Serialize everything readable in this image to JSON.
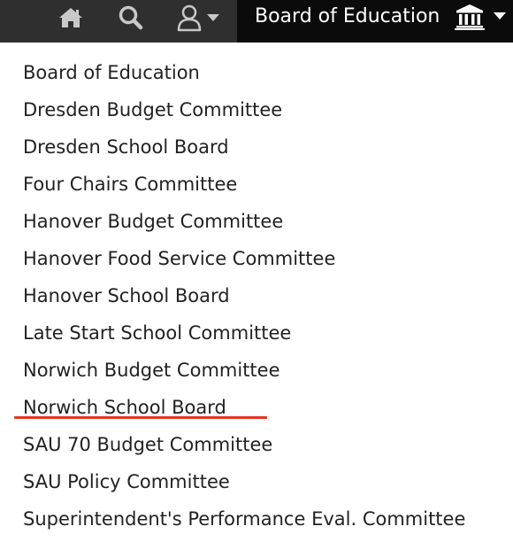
{
  "topbar": {
    "context_title": "Board of Education",
    "icons": {
      "home": "home-icon",
      "search": "search-icon",
      "user": "user-icon",
      "building": "building-icon"
    }
  },
  "menu": {
    "items": [
      {
        "label": "Board of Education"
      },
      {
        "label": "Dresden Budget Committee"
      },
      {
        "label": "Dresden School Board"
      },
      {
        "label": "Four Chairs Committee"
      },
      {
        "label": "Hanover Budget Committee"
      },
      {
        "label": "Hanover Food Service Committee"
      },
      {
        "label": "Hanover School Board"
      },
      {
        "label": "Late Start School Committee"
      },
      {
        "label": "Norwich Budget Committee"
      },
      {
        "label": "Norwich School Board"
      },
      {
        "label": "SAU 70 Budget Committee"
      },
      {
        "label": "SAU Policy Committee"
      },
      {
        "label": "Superintendent's Performance Eval. Committee"
      }
    ],
    "highlighted_item": "Norwich School Board"
  },
  "colors": {
    "topbar_bg": "#2f2f2f",
    "context_bg": "#0b0b0b",
    "icon_gray": "#c8c8c8",
    "text": "#222222",
    "underline": "#e8321f"
  }
}
